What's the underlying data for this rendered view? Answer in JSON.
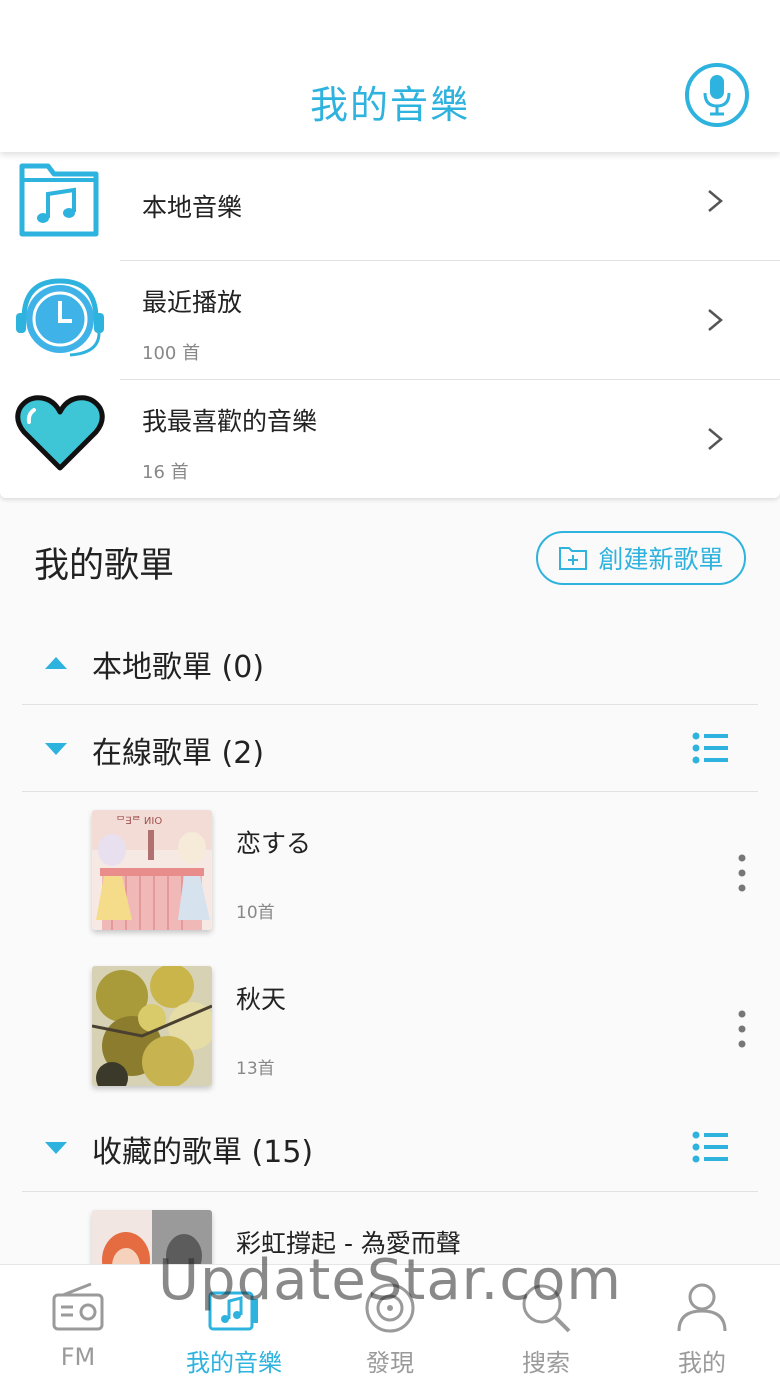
{
  "header": {
    "title": "我的音樂",
    "mic_icon": "microphone-icon"
  },
  "quick_access": [
    {
      "title": "本地音樂",
      "subtitle": "",
      "icon": "music-folder-icon"
    },
    {
      "title": "最近播放",
      "subtitle": "100 首",
      "icon": "clock-headset-icon"
    },
    {
      "title": "我最喜歡的音樂",
      "subtitle": "16 首",
      "icon": "heart-icon"
    }
  ],
  "playlists_section": {
    "title": "我的歌單",
    "create_label": "創建新歌單"
  },
  "groups": [
    {
      "label": "本地歌單 (0)",
      "expanded": false
    },
    {
      "label": "在線歌單 (2)",
      "expanded": true
    },
    {
      "label": "收藏的歌單 (15)",
      "expanded": true
    }
  ],
  "online_playlists": [
    {
      "name": "恋する",
      "count": "10首"
    },
    {
      "name": "秋天",
      "count": "13首"
    }
  ],
  "favorited_playlists": [
    {
      "name": "彩虹撐起 - 為愛而聲"
    }
  ],
  "tabs": [
    {
      "label": "FM",
      "icon": "radio-icon",
      "active": false
    },
    {
      "label": "我的音樂",
      "icon": "my-music-icon",
      "active": true
    },
    {
      "label": "發現",
      "icon": "disc-icon",
      "active": false
    },
    {
      "label": "搜索",
      "icon": "search-icon",
      "active": false
    },
    {
      "label": "我的",
      "icon": "user-icon",
      "active": false
    }
  ],
  "watermark": "UpdateStar.com",
  "colors": {
    "accent": "#2eb2de",
    "text": "#222222",
    "muted": "#888888"
  }
}
